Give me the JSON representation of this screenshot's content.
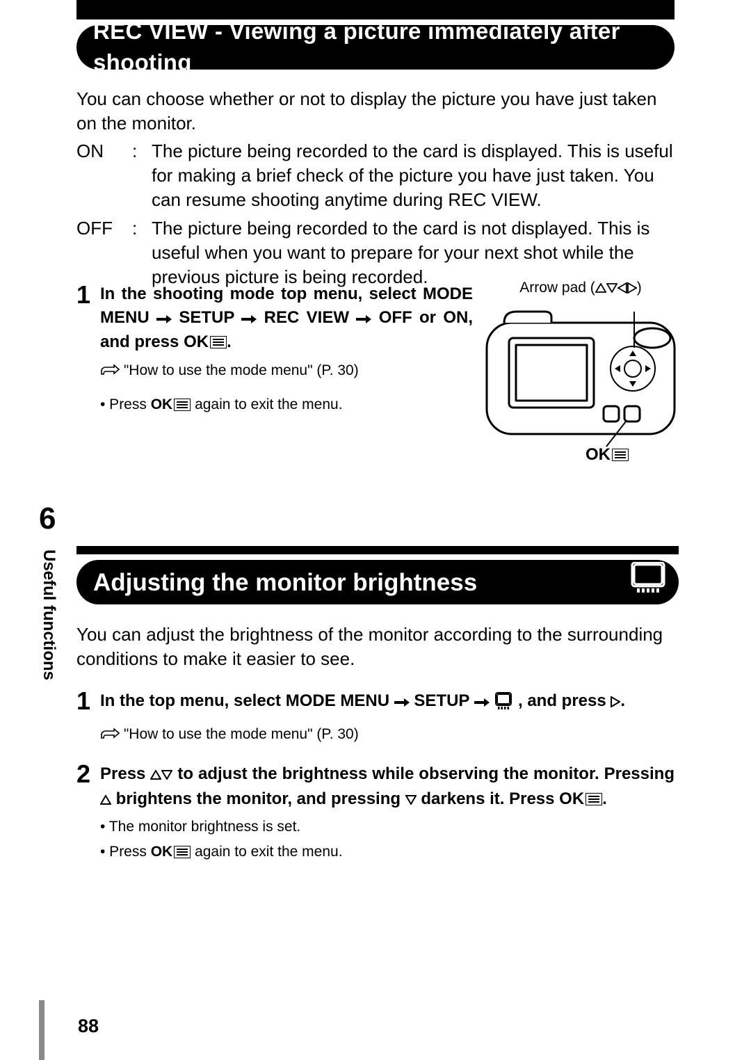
{
  "header": {
    "title": "REC VIEW - Viewing a picture immediately after shooting"
  },
  "intro": "You can choose whether or not to display the picture you have just taken on the monitor.",
  "options": {
    "on": {
      "label": "ON",
      "description": "The picture being recorded to the card is displayed. This is useful for making a brief check of the picture you have just taken. You can resume shooting anytime during REC VIEW."
    },
    "off": {
      "label": "OFF",
      "description": "The picture being recorded to the card is not displayed. This is useful when you want to prepare for your next shot while the previous picture is being recorded."
    }
  },
  "step1": {
    "num": "1",
    "inst_a": "In the shooting mode top menu, select MODE MENU",
    "inst_b": "SETUP",
    "inst_c": "REC VIEW",
    "inst_d": "OFF or ON, and press",
    "inst_e": ".",
    "ok": "OK",
    "ref": "\"How to use the mode menu\" (P. 30)",
    "bullet_pre": "• Press",
    "bullet_post": " again to exit the menu."
  },
  "figure": {
    "caption_pre": "Arrow pad (",
    "caption_post": ")",
    "ok": "OK"
  },
  "section6_number": "6",
  "tab_label": "Useful functions",
  "header2": {
    "title": "Adjusting the monitor brightness"
  },
  "intro2": "You can adjust the brightness of the monitor according to the surrounding conditions to make it easier to see.",
  "step2_1": {
    "num": "1",
    "inst_a": "In the top menu, select MODE MENU",
    "inst_b": "SETUP",
    "inst_c": ", and press",
    "inst_d": ".",
    "ref": "\"How to use the mode menu\" (P. 30)"
  },
  "step2_2": {
    "num": "2",
    "inst_a": "Press",
    "inst_b": "to adjust the brightness while observing the monitor. Pressing",
    "inst_c": "brightens the monitor, and pressing",
    "inst_d": "darkens it. Press",
    "inst_e": ".",
    "ok": "OK",
    "b1": "• The monitor brightness is set.",
    "b2_pre": "• Press",
    "b2_post": " again to exit the menu."
  },
  "page_number": "88"
}
